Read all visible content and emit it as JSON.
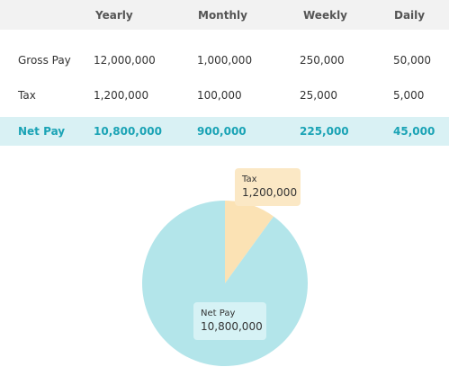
{
  "table": {
    "headers": [
      "Yearly",
      "Monthly",
      "Weekly",
      "Daily"
    ],
    "rows": [
      {
        "label": "Gross Pay",
        "yearly": "12,000,000",
        "monthly": "1,000,000",
        "weekly": "250,000",
        "daily": "50,000"
      },
      {
        "label": "Tax",
        "yearly": "1,200,000",
        "monthly": "100,000",
        "weekly": "25,000",
        "daily": "5,000"
      },
      {
        "label": "Net Pay",
        "yearly": "10,800,000",
        "monthly": "900,000",
        "weekly": "225,000",
        "daily": "45,000"
      }
    ]
  },
  "chart_data": {
    "type": "pie",
    "slices": [
      {
        "name": "Tax",
        "label": "1,200,000",
        "value": 1200000,
        "color": "#fbe2b4"
      },
      {
        "name": "Net Pay",
        "label": "10,800,000",
        "value": 10800000,
        "color": "#b3e5ea"
      }
    ]
  },
  "colors": {
    "accent": "#1aa3b5",
    "net_row_bg": "#d9f1f4",
    "header_bg": "#f2f2f2"
  }
}
